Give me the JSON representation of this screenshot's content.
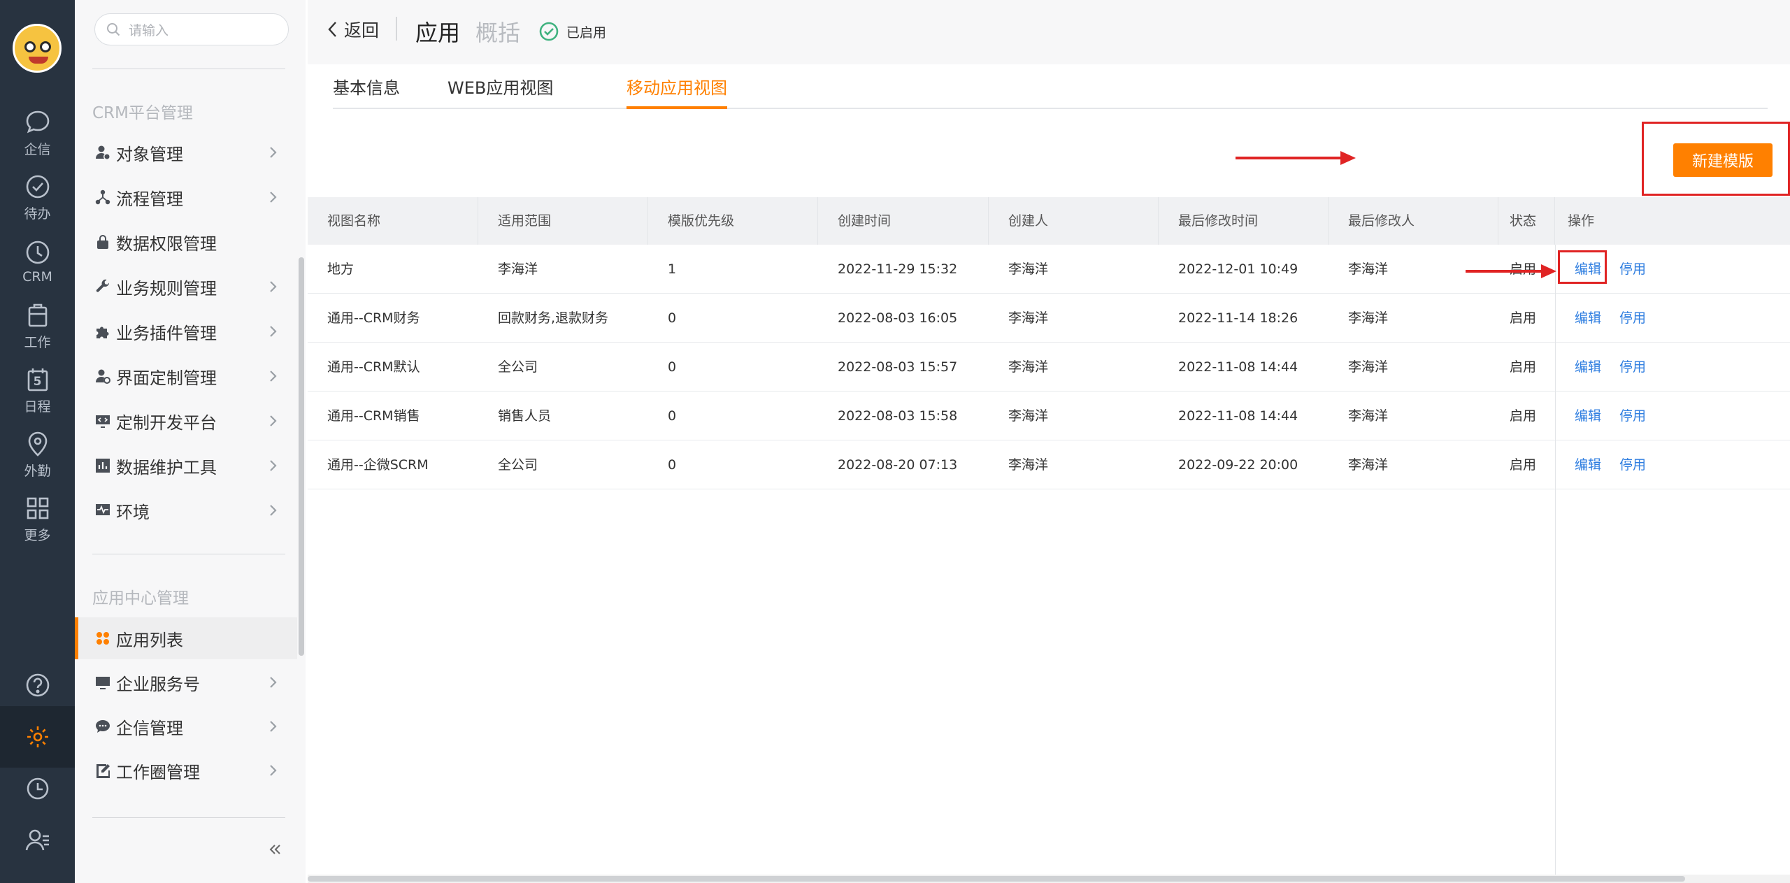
{
  "rail": {
    "items": [
      {
        "label": "企信",
        "icon": "chat-bubble-icon"
      },
      {
        "label": "待办",
        "icon": "check-circle-icon"
      },
      {
        "label": "CRM",
        "icon": "clock-icon"
      },
      {
        "label": "工作",
        "icon": "clipboard-icon"
      },
      {
        "label": "日程",
        "icon": "calendar-icon",
        "calendar_day": "5"
      },
      {
        "label": "外勤",
        "icon": "location-pin-icon"
      },
      {
        "label": "更多",
        "icon": "grid-icon"
      }
    ],
    "bottom_icons": [
      "help-icon",
      "settings-gear-icon",
      "history-clock-icon",
      "user-manage-icon"
    ],
    "active_color": "#ff8000"
  },
  "menu": {
    "search_placeholder": "请输入",
    "section1": "CRM平台管理",
    "items1": [
      {
        "label": "对象管理",
        "icon": "object-user-icon"
      },
      {
        "label": "流程管理",
        "icon": "flow-icon"
      },
      {
        "label": "数据权限管理",
        "icon": "lock-icon"
      },
      {
        "label": "业务规则管理",
        "icon": "wrench-icon"
      },
      {
        "label": "业务插件管理",
        "icon": "puzzle-icon"
      },
      {
        "label": "界面定制管理",
        "icon": "ui-custom-icon"
      },
      {
        "label": "定制开发平台",
        "icon": "monitor-code-icon"
      },
      {
        "label": "数据维护工具",
        "icon": "bar-chart-icon"
      },
      {
        "label": "环境",
        "icon": "pulse-icon"
      }
    ],
    "section2": "应用中心管理",
    "items2": [
      {
        "label": "应用列表",
        "icon": "apps-icon"
      },
      {
        "label": "企业服务号",
        "icon": "monitor-icon"
      },
      {
        "label": "企信管理",
        "icon": "chat-dots-icon"
      },
      {
        "label": "工作圈管理",
        "icon": "edit-note-icon"
      }
    ]
  },
  "topbar": {
    "back_label": "返回",
    "title": "应用",
    "subtitle": "概括",
    "status": "已启用"
  },
  "tabs": [
    "基本信息",
    "WEB应用视图",
    "移动应用视图"
  ],
  "new_template_button": "新建模版",
  "table": {
    "headers": [
      "视图名称",
      "适用范围",
      "模版优先级",
      "创建时间",
      "创建人",
      "最后修改时间",
      "最后修改人",
      "状态",
      "操作"
    ],
    "rows": [
      {
        "name": "地方",
        "scope": "李海洋",
        "priority": "1",
        "created": "2022-11-29 15:32",
        "creator": "李海洋",
        "modified": "2022-12-01 10:49",
        "modifier": "李海洋",
        "status": "启用",
        "edit": "编辑",
        "disable": "停用"
      },
      {
        "name": "通用--CRM财务",
        "scope": "回款财务,退款财务",
        "priority": "0",
        "created": "2022-08-03 16:05",
        "creator": "李海洋",
        "modified": "2022-11-14 18:26",
        "modifier": "李海洋",
        "status": "启用",
        "edit": "编辑",
        "disable": "停用"
      },
      {
        "name": "通用--CRM默认",
        "scope": "全公司",
        "priority": "0",
        "created": "2022-08-03 15:57",
        "creator": "李海洋",
        "modified": "2022-11-08 14:44",
        "modifier": "李海洋",
        "status": "启用",
        "edit": "编辑",
        "disable": "停用"
      },
      {
        "name": "通用--CRM销售",
        "scope": "销售人员",
        "priority": "0",
        "created": "2022-08-03 15:58",
        "creator": "李海洋",
        "modified": "2022-11-08 14:44",
        "modifier": "李海洋",
        "status": "启用",
        "edit": "编辑",
        "disable": "停用"
      },
      {
        "name": "通用--企微SCRM",
        "scope": "全公司",
        "priority": "0",
        "created": "2022-08-20 07:13",
        "creator": "李海洋",
        "modified": "2022-09-22 20:00",
        "modifier": "李海洋",
        "status": "启用",
        "edit": "编辑",
        "disable": "停用"
      }
    ]
  },
  "colors": {
    "accent": "#ff8000",
    "link": "#2f7ee0",
    "annotation": "#e02424",
    "status_ok": "#3fb27f"
  }
}
